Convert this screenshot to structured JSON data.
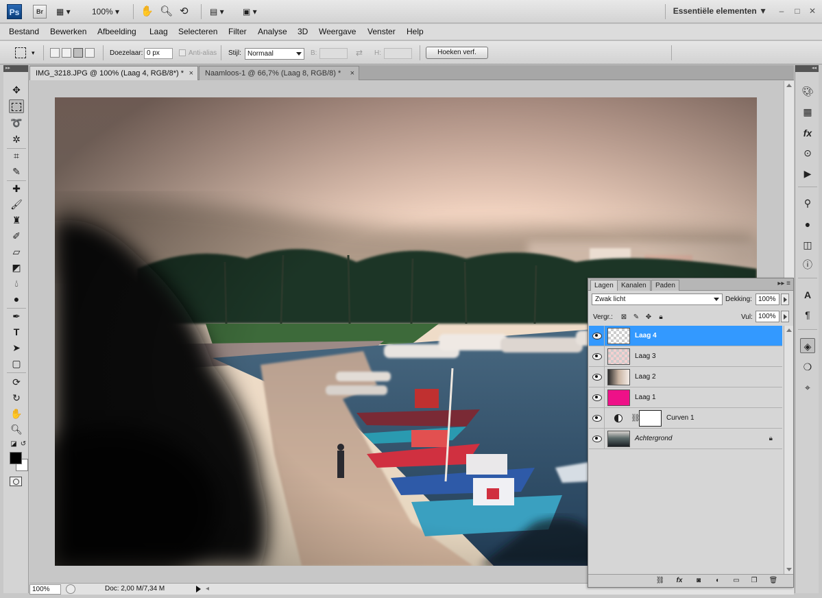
{
  "app": {
    "logo": "Ps",
    "bridge": "Br",
    "zoom": "100%",
    "workspace": "Essentiële elementen",
    "workspace_arrow": "▼"
  },
  "menu": [
    "Bestand",
    "Bewerken",
    "Afbeelding",
    "Laag",
    "Selecteren",
    "Filter",
    "Analyse",
    "3D",
    "Weergave",
    "Venster",
    "Help"
  ],
  "options": {
    "feather_label": "Doezelaar:",
    "feather_value": "0 px",
    "antialias_label": "Anti-alias",
    "style_label": "Stijl:",
    "style_value": "Normaal",
    "width_label": "B:",
    "height_label": "H:",
    "refine_button": "Hoeken verf."
  },
  "tabs": [
    {
      "label": "IMG_3218.JPG @ 100% (Laag 4, RGB/8*) *",
      "close": "×",
      "active": true
    },
    {
      "label": "Naamloos-1 @ 66,7% (Laag 8, RGB/8) *",
      "close": "×",
      "active": false
    }
  ],
  "status": {
    "zoom": "100%",
    "doc_info": "Doc: 2,00 M/7,34 M"
  },
  "layers_panel": {
    "tabs": [
      "Lagen",
      "Kanalen",
      "Paden"
    ],
    "blend_mode": "Zwak licht",
    "opacity_label": "Dekking:",
    "opacity": "100%",
    "lock_label": "Vergr.:",
    "fill_label": "Vul:",
    "fill": "100%",
    "layers": [
      {
        "name": "Laag 4",
        "selected": true,
        "thumb": "checker"
      },
      {
        "name": "Laag 3",
        "selected": false,
        "thumb": "checker-red"
      },
      {
        "name": "Laag 2",
        "selected": false,
        "thumb": "photo-fade"
      },
      {
        "name": "Laag 1",
        "selected": false,
        "thumb": "magenta"
      },
      {
        "name": "Curven 1",
        "selected": false,
        "thumb": "adjustment"
      },
      {
        "name": "Achtergrond",
        "selected": false,
        "thumb": "photo"
      }
    ]
  },
  "colors": {
    "accent": "#3399ff",
    "layer1_fill": "#ee1188",
    "foreground": "#000000",
    "background": "#ffffff"
  }
}
